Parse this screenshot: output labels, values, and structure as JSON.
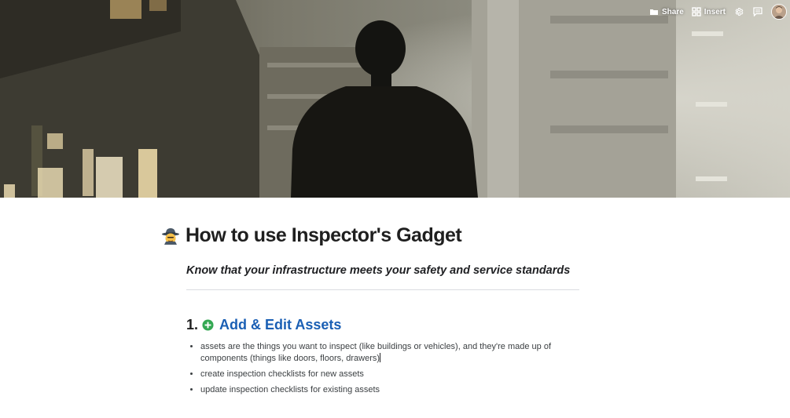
{
  "toolbar": {
    "share_label": "Share",
    "insert_label": "Insert",
    "share_icon": "folder-icon",
    "insert_icon": "grid-icon",
    "settings_icon": "gear-icon",
    "comments_icon": "comment-icon"
  },
  "doc": {
    "icon": "detective-emoji",
    "title": "How to use Inspector's Gadget",
    "subtitle": "Know that your infrastructure meets your safety and service standards"
  },
  "section": {
    "number": "1.",
    "icon": "plus-circle-icon",
    "title": "Add & Edit Assets",
    "bullets": [
      "assets are the things you want to inspect (like buildings or vehicles), and they're made up of components (things like doors, floors, drawers)",
      "create inspection checklists for new assets",
      "update inspection checklists for existing assets"
    ]
  },
  "colors": {
    "heading_blue": "#1a5fb4",
    "plus_green": "#34a853"
  }
}
